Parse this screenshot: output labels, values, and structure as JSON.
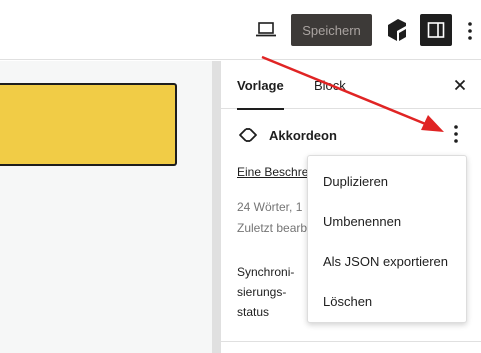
{
  "toolbar": {
    "save_label": "Speichern",
    "preview_icon": "laptop-icon",
    "plugin_icon": "plugin-logo-icon",
    "settings_icon": "sidebar-toggle-icon",
    "more_icon": "vertical-dots-icon"
  },
  "sidebar": {
    "tabs": [
      {
        "label": "Vorlage"
      },
      {
        "label": "Block"
      }
    ],
    "block": {
      "title": "Akkordeon",
      "icon": "accordion-chevrons-icon"
    },
    "description_link": "Eine Beschre",
    "meta": {
      "words": "24 Wörter, 1",
      "last_edited": "Zuletzt bearb"
    },
    "sync_label": "Synchroni-\nsierungs-\nstatus"
  },
  "menu": {
    "items": [
      {
        "label": "Duplizieren"
      },
      {
        "label": "Umbenennen"
      },
      {
        "label": "Als JSON exportieren"
      },
      {
        "label": "Löschen"
      }
    ]
  },
  "colors": {
    "block_yellow": "#f1cc46",
    "save_button_bg": "#3d3a38",
    "annotation_arrow": "#e02424"
  }
}
